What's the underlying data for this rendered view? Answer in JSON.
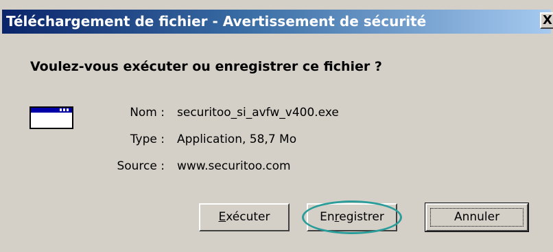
{
  "dialog": {
    "title": "Téléchargement de fichier - Avertissement de sécurité",
    "close_label": "X",
    "question": "Voulez-vous exécuter ou enregistrer ce fichier ?"
  },
  "file": {
    "name_label": "Nom :",
    "name_value": "securitoo_si_avfw_v400.exe",
    "type_label": "Type :",
    "type_value": "Application, 58,7 Mo",
    "source_label": "Source :",
    "source_value": "www.securitoo.com",
    "icon": "application-window-icon"
  },
  "buttons": {
    "run_label_mnemonic": "E",
    "run_label_rest": "xécuter",
    "save_label_first": "En",
    "save_label_mnemonic": "r",
    "save_label_rest": "egistrer",
    "cancel_label": "Annuler"
  },
  "annotation": {
    "highlight_color": "#2a9d9a",
    "highlighted": "save-button"
  },
  "colors": {
    "titlebar_start": "#0a246a",
    "titlebar_end": "#a6caf0",
    "dialog_bg": "#d4d0c8"
  }
}
